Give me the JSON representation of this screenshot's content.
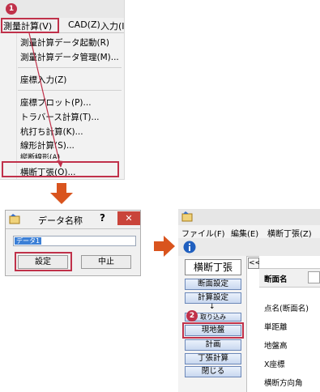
{
  "callouts": {
    "step1": "1",
    "step2": "2"
  },
  "menu_panel": {
    "menubar": [
      "測量計算(V)",
      "CAD(Z)",
      "入力(I"
    ],
    "items": [
      "測量計算データ起動(R)",
      "測量計算データ管理(M)...",
      "座標入力(Z)",
      "座標プロット(P)...",
      "トラバース計算(T)...",
      "杭打ち計算(K)...",
      "線形計算(S)...",
      "縦断線形(A)",
      "横断丁張(O)..."
    ]
  },
  "dialog": {
    "title": "データ名称",
    "help_label": "?",
    "close_label": "✕",
    "input_value": "データ1",
    "ok_label": "設定",
    "cancel_label": "中止"
  },
  "app": {
    "menubar": [
      "ファイル(F)",
      "編集(E)",
      "横断丁張(Z)"
    ],
    "toolbar_icon": "info-icon",
    "sidebar_title": "横断丁張",
    "collapse_label": "<<",
    "sidebar_buttons": [
      "断面設定",
      "計算設定",
      "取り込み",
      "現地盤",
      "計画",
      "丁張計算",
      "閉じる"
    ],
    "flow_arrow": "↓",
    "content_header_label": "断面名",
    "field_labels": [
      "点名(断面名)",
      "単距離",
      "地盤高",
      "X座標",
      "横断方向角"
    ]
  },
  "colors": {
    "callout": "#c0314a",
    "arrow": "#d9541e",
    "close_button": "#c9443a",
    "info_icon": "#1f5fbf"
  }
}
